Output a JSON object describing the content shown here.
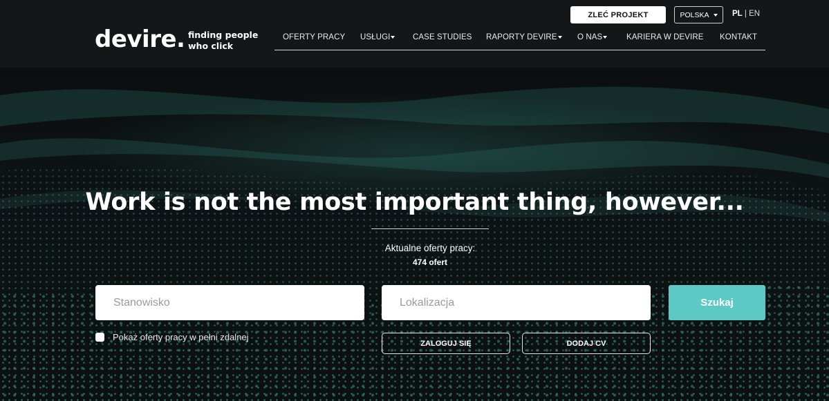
{
  "header": {
    "logo": "devire.",
    "tagline_line1": "finding people",
    "tagline_line2": "who click",
    "project_button": "ZLEĆ PROJEKT",
    "country_select": "POLSKA",
    "lang_active": "PL",
    "lang_separator": "|",
    "lang_other": "EN",
    "nav": [
      {
        "label": "OFERTY PRACY",
        "dropdown": false
      },
      {
        "label": "USŁUGI",
        "dropdown": true
      },
      {
        "label": "CASE STUDIES",
        "dropdown": false
      },
      {
        "label": "RAPORTY DEVIRE",
        "dropdown": true
      },
      {
        "label": "O NAS",
        "dropdown": true
      },
      {
        "label": "KARIERA W DEVIRE",
        "dropdown": false
      },
      {
        "label": "KONTAKT",
        "dropdown": false
      }
    ]
  },
  "hero": {
    "headline": "Work is not the most important thing, however...",
    "offers_label": "Aktualne oferty pracy:",
    "offers_count": "474 ofert",
    "position_placeholder": "Stanowisko",
    "location_placeholder": "Lokalizacja",
    "search_button": "Szukaj",
    "remote_label": "Pokaż oferty pracy w pełni zdalnej",
    "login_button": "ZALOGUJ SIĘ",
    "add_cv_button": "DODAJ CV"
  },
  "colors": {
    "accent": "#5cc9c4",
    "header_bg": "#141617",
    "wave": "#4fd1bf"
  },
  "icons": {
    "caret": "caret-down-icon"
  }
}
